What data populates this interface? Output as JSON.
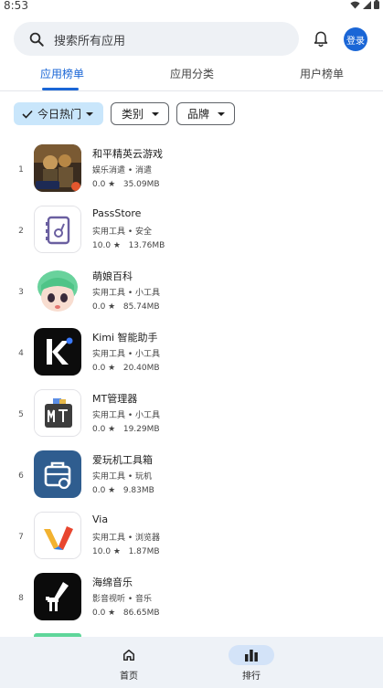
{
  "status_bar": {
    "time": "8:53"
  },
  "search": {
    "placeholder": "搜索所有应用"
  },
  "header": {
    "login_label": "登录"
  },
  "tabs": [
    {
      "label": "应用榜单",
      "active": true
    },
    {
      "label": "应用分类",
      "active": false
    },
    {
      "label": "用户榜单",
      "active": false
    }
  ],
  "filters": [
    {
      "label": "今日热门",
      "selected": true
    },
    {
      "label": "类别",
      "selected": false
    },
    {
      "label": "品牌",
      "selected": false
    }
  ],
  "apps": [
    {
      "rank": "1",
      "name": "和平精英云游戏",
      "category": "娱乐消遣 • 消遣",
      "rating": "0.0 ★",
      "size": "35.09MB",
      "icon": "game-icon"
    },
    {
      "rank": "2",
      "name": "PassStore",
      "category": "实用工具 • 安全",
      "rating": "10.0 ★",
      "size": "13.76MB",
      "icon": "passstore-icon"
    },
    {
      "rank": "3",
      "name": "萌娘百科",
      "category": "实用工具 • 小工具",
      "rating": "0.0 ★",
      "size": "85.74MB",
      "icon": "anime-girl-icon"
    },
    {
      "rank": "4",
      "name": "Kimi 智能助手",
      "category": "实用工具 • 小工具",
      "rating": "0.0 ★",
      "size": "20.40MB",
      "icon": "kimi-icon"
    },
    {
      "rank": "5",
      "name": "MT管理器",
      "category": "实用工具 • 小工具",
      "rating": "0.0 ★",
      "size": "19.29MB",
      "icon": "mt-manager-icon"
    },
    {
      "rank": "6",
      "name": "爱玩机工具箱",
      "category": "实用工具 • 玩机",
      "rating": "0.0 ★",
      "size": "9.83MB",
      "icon": "toolbox-icon"
    },
    {
      "rank": "7",
      "name": "Via",
      "category": "实用工具 • 浏览器",
      "rating": "10.0 ★",
      "size": "1.87MB",
      "icon": "via-browser-icon"
    },
    {
      "rank": "8",
      "name": "海绵音乐",
      "category": "影音视听 • 音乐",
      "rating": "0.0 ★",
      "size": "86.65MB",
      "icon": "music-icon"
    }
  ],
  "bottom_nav": [
    {
      "label": "首页",
      "icon": "home-icon",
      "active": false
    },
    {
      "label": "排行",
      "icon": "bar-chart-icon",
      "active": true
    }
  ],
  "colors": {
    "accent": "#1a66d6",
    "chip_selected": "#c9e6fb",
    "nav_bg": "#eef2f7"
  }
}
